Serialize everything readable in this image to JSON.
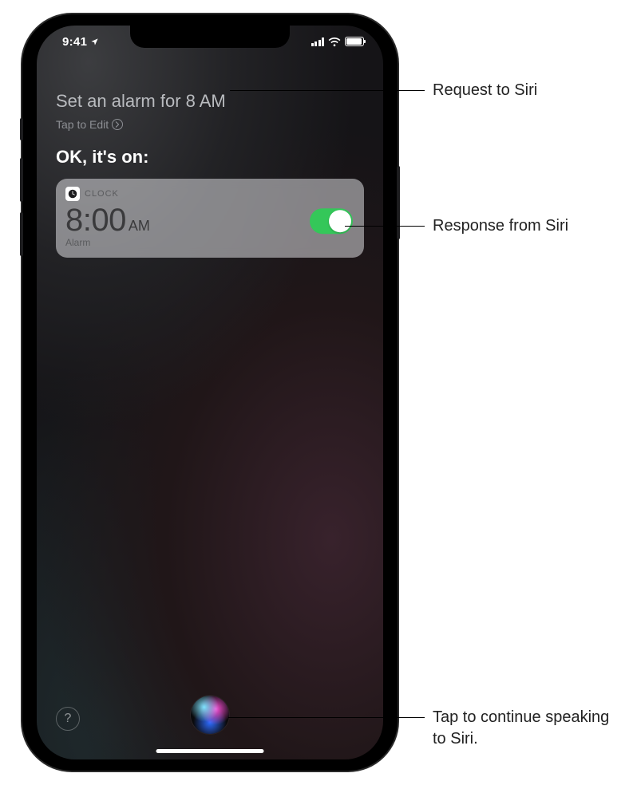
{
  "statusbar": {
    "time": "9:41"
  },
  "siri": {
    "request": "Set an alarm for 8 AM",
    "tap_to_edit": "Tap to Edit",
    "response": "OK, it's on:"
  },
  "card": {
    "app_name": "CLOCK",
    "time": "8:00",
    "ampm": "AM",
    "subtitle": "Alarm",
    "toggle_on": true
  },
  "help": {
    "symbol": "?"
  },
  "callouts": {
    "request": "Request to Siri",
    "response": "Response from Siri",
    "orb": "Tap to continue speaking to Siri."
  }
}
